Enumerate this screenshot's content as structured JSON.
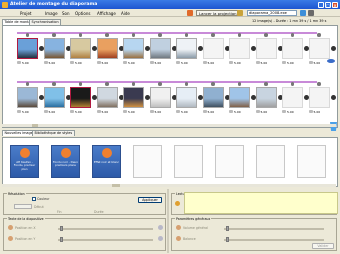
{
  "window": {
    "title": "Atelier de montage du diaporama"
  },
  "menu": [
    "Projet",
    "Image",
    "Son",
    "Options",
    "Affichage",
    "Aide"
  ],
  "toolbar": {
    "projection_label": "Lancer la projection",
    "filename": "diaporama_2008.exe"
  },
  "tabs": [
    "Table de montage",
    "Synchronisation"
  ],
  "status": "12 image(s) - Durée : 1 mn 39 s / 1 mn 39 s",
  "row1": {
    "durations": [
      "5.00",
      "5.00",
      "5.00",
      "5.00",
      "5.00",
      "5.00",
      "5.00",
      "5.00",
      "5.00",
      "5.00",
      "5.00",
      "5.00"
    ]
  },
  "row2": {
    "durations": [
      "5.00",
      "5.00",
      "5.00",
      "5.00",
      "5.00",
      "5.00",
      "5.00",
      "5.00",
      "5.00",
      "5.00",
      "5.00",
      "5.00"
    ]
  },
  "panel_tabs": [
    "Nouvelles images",
    "Bibliothèque de styles"
  ],
  "presets": [
    {
      "label": "AH Kaufen - Fondu, premier plan"
    },
    {
      "label": "Fondu noir - Deux premiers plans"
    },
    {
      "label": "Effet noir et blanc"
    }
  ],
  "lower": {
    "grp_resolution": "Résolution",
    "lbl_couleur": "Couleur",
    "lbl_debut": "Début",
    "lbl_fin": "Fin",
    "lbl_duree": "Durée",
    "btn_appliquer": "Appliquer",
    "grp_texte": "Texte de la diapositive",
    "lbl_position_x": "Position en X",
    "lbl_position_y": "Position en Y",
    "grp_lecture": "Lecture du son",
    "grp_params": "Paramètres généraux",
    "lbl_volume": "Volume général",
    "lbl_balance": "Balance",
    "btn_valider": "Valider"
  }
}
